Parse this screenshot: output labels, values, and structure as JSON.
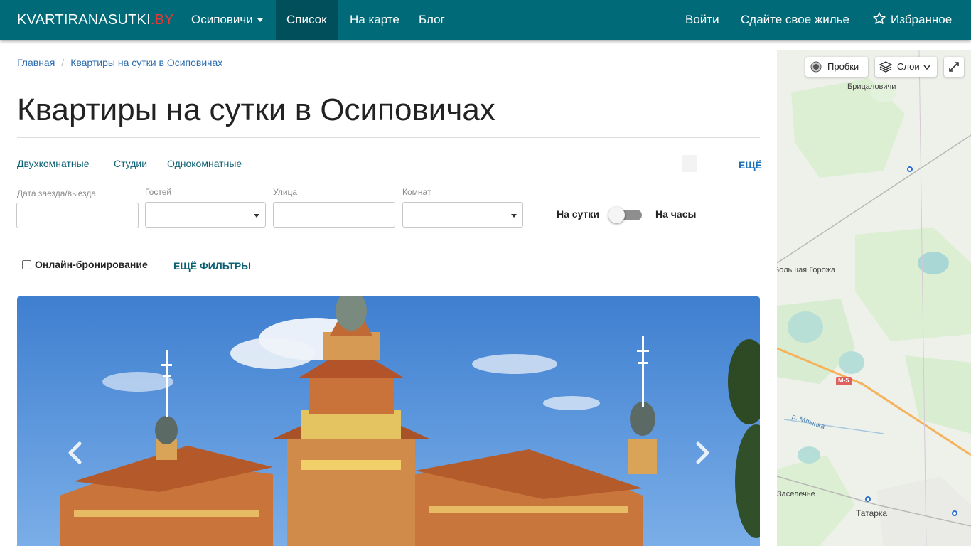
{
  "brand": {
    "name": "KVARTIRANASUTKI",
    "tld": ".BY"
  },
  "nav": {
    "city": "Осиповичи",
    "list": "Список",
    "map": "На карте",
    "blog": "Блог",
    "login": "Войти",
    "rent_out": "Сдайте свое жилье",
    "favorites": "Избранное"
  },
  "breadcrumb": {
    "home": "Главная",
    "current": "Квартиры на сутки в Осиповичах"
  },
  "page_title": "Квартиры на сутки в Осиповичах",
  "quick_links": [
    "Двухкомнатные",
    "Студии",
    "Однокомнатные"
  ],
  "more": "ЕЩЁ",
  "filters": {
    "dates_label": "Дата заезда/выезда",
    "dates_value": "",
    "guests_label": "Гостей",
    "guests_value": "",
    "street_label": "Улица",
    "street_value": "",
    "rooms_label": "Комнат",
    "rooms_value": "",
    "toggle_left": "На сутки",
    "toggle_right": "На часы",
    "hourly_enabled": false,
    "online_booking": "Онлайн-бронирование",
    "online_checked": false,
    "more_filters": "ЕЩЁ ФИЛЬТРЫ"
  },
  "map": {
    "traffic": "Пробки",
    "layers": "Слои",
    "places": [
      "Брицаловичи",
      "Большая Горожа",
      "Заселечье",
      "Татарка",
      "р. Млынка",
      "М-5"
    ]
  },
  "colors": {
    "navbar": "#006a78",
    "navbar_active": "#004f5b",
    "link": "#2a6cb0",
    "tld": "#e53935"
  }
}
